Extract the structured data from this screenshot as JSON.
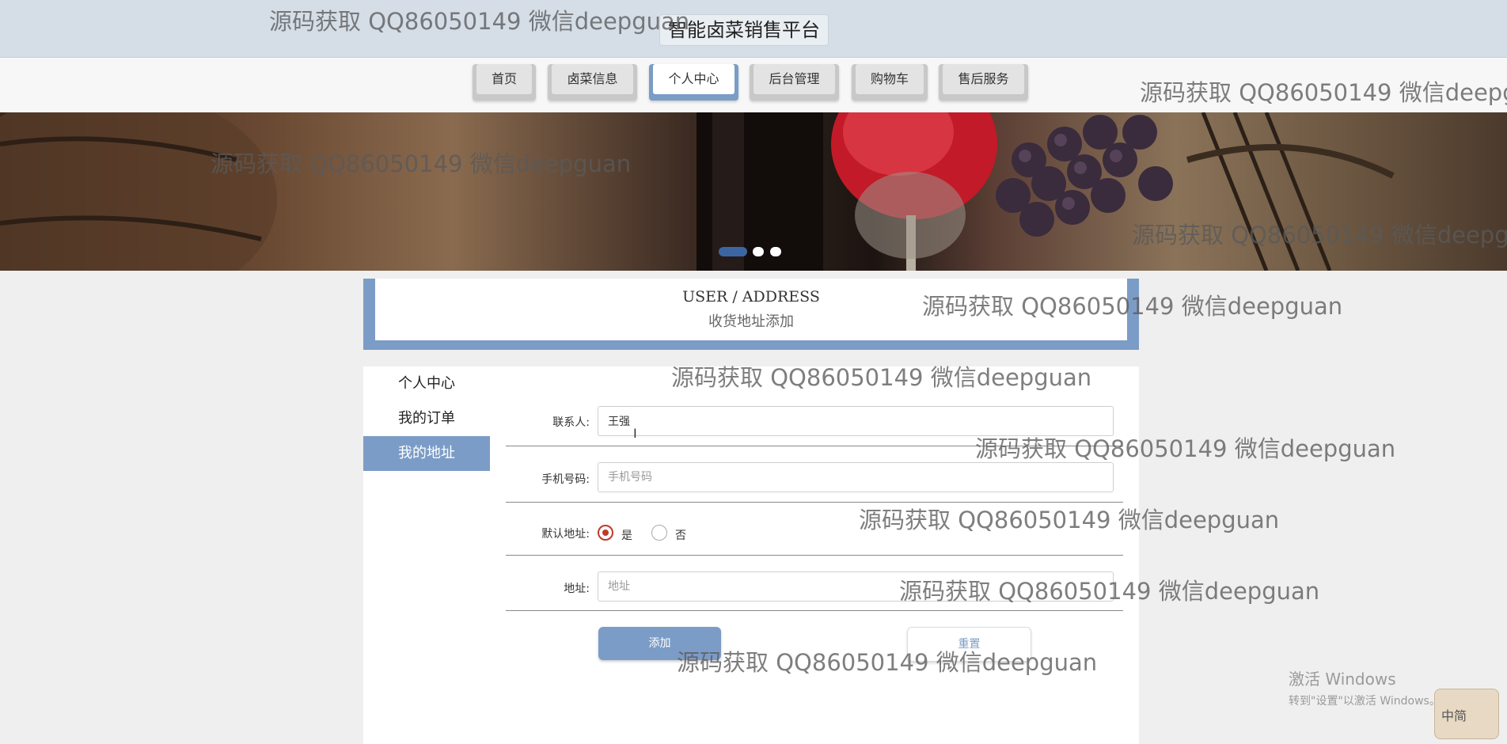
{
  "header": {
    "site_title": "智能卤菜销售平台"
  },
  "nav": {
    "items": [
      {
        "label": "首页",
        "active": false
      },
      {
        "label": "卤菜信息",
        "active": false
      },
      {
        "label": "个人中心",
        "active": true
      },
      {
        "label": "后台管理",
        "active": false
      },
      {
        "label": "购物车",
        "active": false
      },
      {
        "label": "售后服务",
        "active": false
      }
    ]
  },
  "banner": {
    "slides": 3,
    "active_slide": 1
  },
  "page_heading": {
    "en": "USER / ADDRESS",
    "cn": "收货地址添加"
  },
  "sidebar": {
    "items": [
      {
        "label": "个人中心",
        "active": false
      },
      {
        "label": "我的订单",
        "active": false
      },
      {
        "label": "我的地址",
        "active": true
      }
    ]
  },
  "form": {
    "contact": {
      "label": "联系人:",
      "value": "王强",
      "placeholder": ""
    },
    "phone": {
      "label": "手机号码:",
      "value": "",
      "placeholder": "手机号码"
    },
    "default_address": {
      "label": "默认地址:",
      "options": [
        {
          "label": "是",
          "checked": true
        },
        {
          "label": "否",
          "checked": false
        }
      ]
    },
    "address": {
      "label": "地址:",
      "value": "",
      "placeholder": "地址"
    },
    "add_button": "添加",
    "reset_button": "重置"
  },
  "watermark_text": "源码获取 QQ86050149 微信deepguan",
  "os_overlay": {
    "activation_title": "激活 Windows",
    "activation_hint": "转到\"设置\"以激活 Windows。",
    "ime_label": "中简"
  }
}
